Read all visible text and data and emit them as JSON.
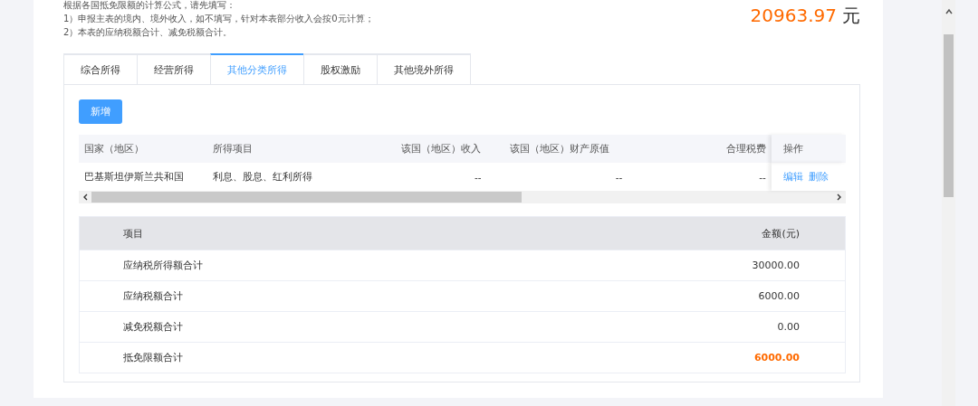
{
  "notes": [
    "根据各国抵免限额的计算公式，请先填写：",
    "1）申报主表的境内、境外收入，如不填写，针对本表部分收入会按0元计算；",
    "2）本表的应纳税额合计、减免税额合计。"
  ],
  "total": {
    "amount": "20963.97",
    "unit": "元"
  },
  "tabs": [
    {
      "label": "综合所得",
      "selected": false
    },
    {
      "label": "经营所得",
      "selected": false
    },
    {
      "label": "其他分类所得",
      "selected": true
    },
    {
      "label": "股权激励",
      "selected": false
    },
    {
      "label": "其他境外所得",
      "selected": false
    }
  ],
  "add_button": "新增",
  "income_table": {
    "columns": [
      "国家（地区）",
      "所得项目",
      "该国（地区）收入",
      "该国（地区）财产原值",
      "合理税费",
      "操作"
    ],
    "rows": [
      {
        "cells": [
          "巴基斯坦伊斯兰共和国",
          "利息、股息、红利所得",
          "--",
          "--",
          "--"
        ],
        "actions": [
          "编辑",
          "删除"
        ]
      }
    ]
  },
  "summary_table": {
    "columns": [
      "项目",
      "金额(元)"
    ],
    "rows": [
      {
        "item": "应纳税所得额合计",
        "amount": "30000.00",
        "emphasis": false
      },
      {
        "item": "应纳税额合计",
        "amount": "6000.00",
        "emphasis": false
      },
      {
        "item": "减免税额合计",
        "amount": "0.00",
        "emphasis": false
      },
      {
        "item": "抵免限额合计",
        "amount": "6000.00",
        "emphasis": true
      }
    ]
  }
}
